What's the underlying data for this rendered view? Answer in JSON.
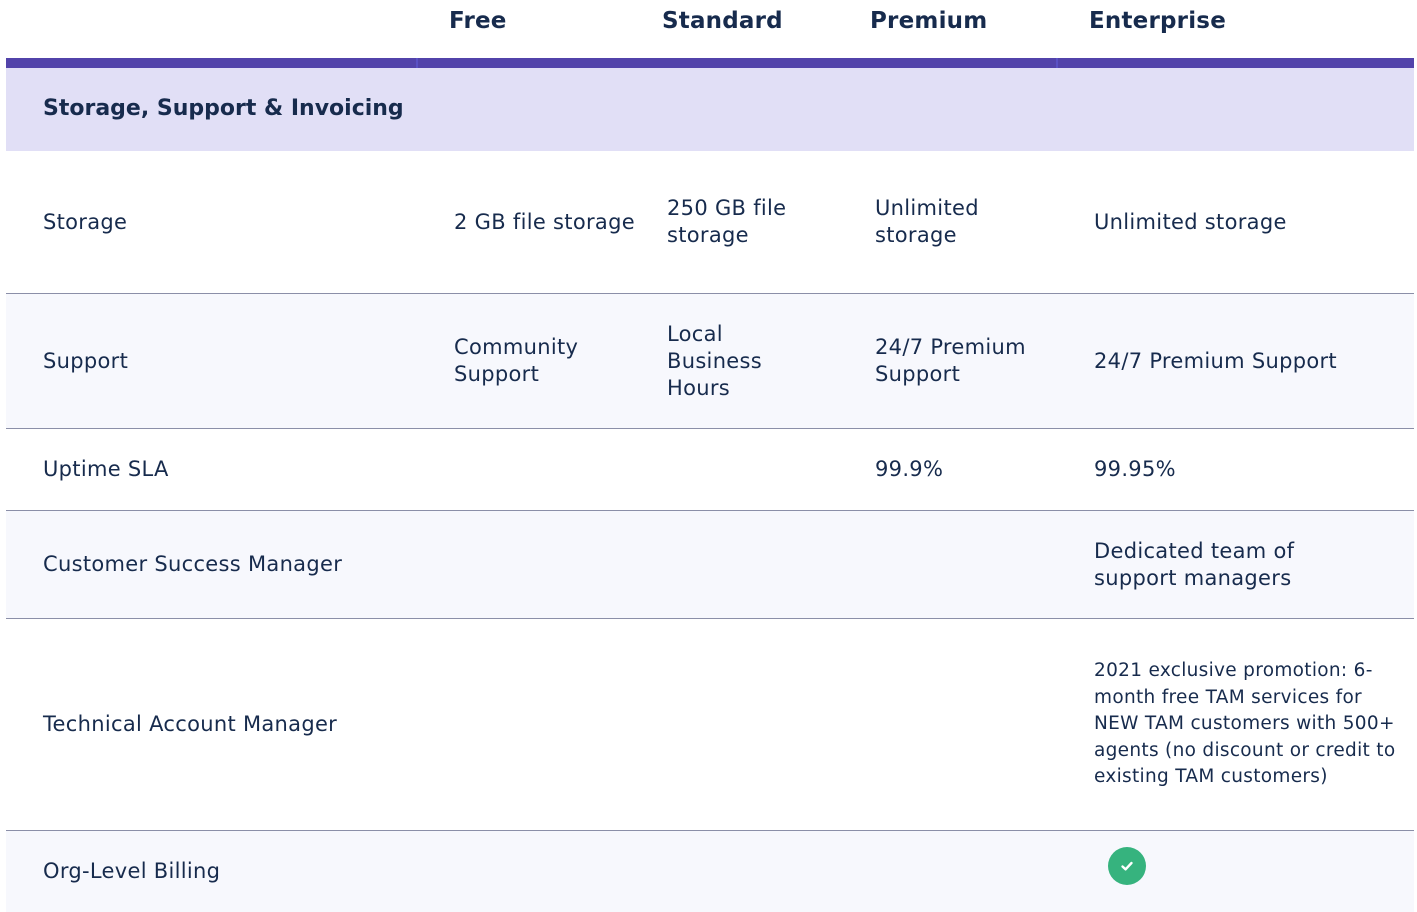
{
  "theme": {
    "accent": "#5243aa",
    "section_bg": "#e1dff6",
    "alt_bg": "#f7f8fd",
    "check": "#36b37e"
  },
  "plans": {
    "free": "Free",
    "standard": "Standard",
    "premium": "Premium",
    "enterprise": "Enterprise"
  },
  "section": {
    "title": "Storage, Support & Invoicing"
  },
  "rows": [
    {
      "feature": "Storage",
      "free": "2 GB file storage",
      "standard": "250 GB file storage",
      "premium": "Unlimited storage",
      "enterprise": "Unlimited storage"
    },
    {
      "feature": "Support",
      "free": "Community Support",
      "standard": "Local Business Hours",
      "premium": "24/7 Premium Support",
      "enterprise": "24/7 Premium Support"
    },
    {
      "feature": "Uptime SLA",
      "free": "",
      "standard": "",
      "premium": "99.9%",
      "enterprise": "99.95%"
    },
    {
      "feature": "Customer Success Manager",
      "free": "",
      "standard": "",
      "premium": "",
      "enterprise": "Dedicated team of support managers"
    },
    {
      "feature": "Technical Account Manager",
      "free": "",
      "standard": "",
      "premium": "",
      "enterprise": "2021 exclusive promotion: 6-month free TAM services for NEW TAM customers with 500+ agents (no discount or credit to existing TAM customers)"
    },
    {
      "feature": "Org-Level Billing",
      "free": "",
      "standard": "",
      "premium": "",
      "enterprise_icon": "check-circle-icon"
    }
  ]
}
